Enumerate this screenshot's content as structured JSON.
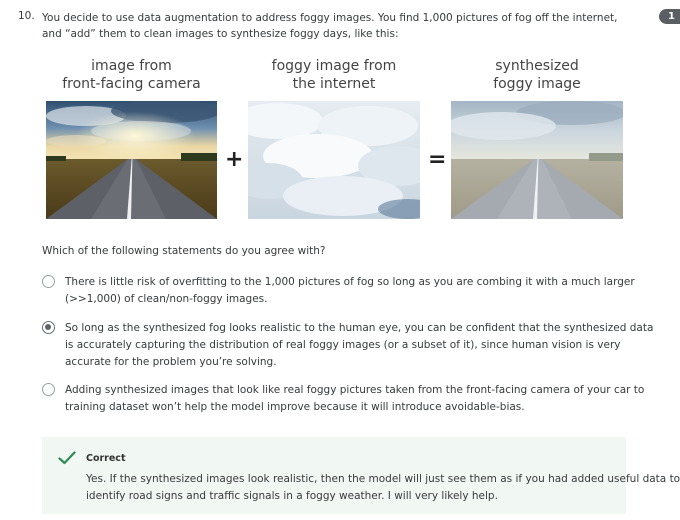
{
  "question": {
    "number": "10.",
    "text": "You decide to use data augmentation to address foggy images. You find 1,000 pictures of fog off the internet, and “add” them to clean images to synthesize foggy days, like this:",
    "points_badge": "1"
  },
  "figure": {
    "captions": [
      "image from\nfront-facing camera",
      "foggy image from\nthe internet",
      "synthesized\nfoggy image"
    ],
    "plus": "+",
    "equals": "="
  },
  "prompt": "Which of the following statements do you agree with?",
  "options": [
    {
      "text": "There is little risk of overfitting to the 1,000 pictures of fog so long as you are combing it with a much larger (>>1,000) of clean/non-foggy images.",
      "selected": false
    },
    {
      "text": "So long as the synthesized fog looks realistic to the human eye, you can be confident that the synthesized data is accurately capturing the distribution of real foggy images (or a subset of it), since human vision is very accurate for the problem you’re solving.",
      "selected": true
    },
    {
      "text": "Adding synthesized images that look like real foggy pictures taken from the front-facing camera of your car to training dataset won’t help the model improve because it will introduce avoidable-bias.",
      "selected": false
    }
  ],
  "feedback": {
    "status": "Correct",
    "text": "Yes. If the synthesized images look realistic, then the model will just see them as if you had added useful data to identify road signs and traffic signals in a foggy weather. I will very likely help."
  },
  "colors": {
    "correct_green": "#2e8b57",
    "feedback_bg": "#f1f7f2",
    "badge_bg": "#5a5f63"
  }
}
